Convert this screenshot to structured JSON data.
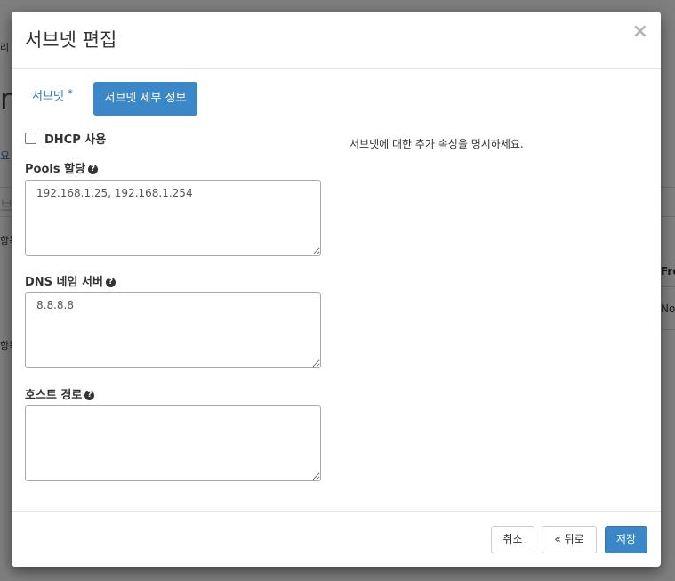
{
  "background": {
    "fragments": [
      "리",
      "ro",
      "요",
      "브",
      "항목",
      "Fre",
      "No",
      "항목"
    ]
  },
  "modal": {
    "title": "서브넷 편집",
    "close_symbol": "×",
    "tabs": [
      {
        "label": "서브넷",
        "required_mark": "*",
        "active": false
      },
      {
        "label": "서브넷 세부 정보",
        "active": true
      }
    ],
    "dhcp": {
      "label": "DHCP 사용",
      "checked": false
    },
    "pools": {
      "label": "Pools 할당",
      "value": "192.168.1.25, 192.168.1.254"
    },
    "dns": {
      "label": "DNS 네임 서버",
      "value": "8.8.8.8"
    },
    "host_routes": {
      "label": "호스트 경로",
      "value": ""
    },
    "help_symbol": "?",
    "help_text": "서브넷에 대한 추가 속성을 명시하세요.",
    "buttons": {
      "cancel": "취소",
      "back": "« 뒤로",
      "save": "저장"
    }
  },
  "colors": {
    "primary": "#3b87c8",
    "link": "#337ab7",
    "overlay": "rgba(0,0,0,0.5)"
  }
}
